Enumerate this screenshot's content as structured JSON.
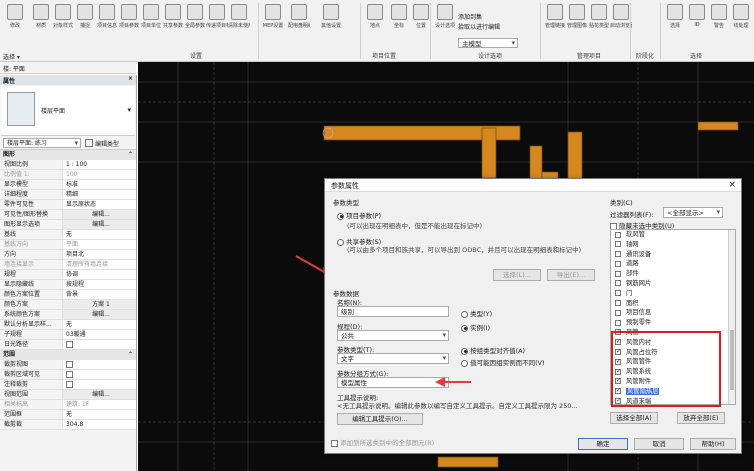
{
  "ribbon": {
    "buttons": [
      "修改",
      "材质",
      "对象样式",
      "捕捉",
      "项目信息",
      "项目参数",
      "项目单位",
      "共享参数",
      "全局参数",
      "传递项目标准",
      "清除未使用项",
      "MEP设置",
      "配电盘明细表样板",
      "其他设置",
      "地点",
      "坐标",
      "位置",
      "设计选项",
      "添加到集",
      "拾取以进行编辑",
      "管理链接",
      "管理图像",
      "贴花类型",
      "启动浏览器",
      "选择",
      "ID",
      "警告",
      "线处理"
    ],
    "groups": [
      "设置",
      "项目位置",
      "设计选项",
      "管理项目",
      "阶段化",
      "选择"
    ],
    "design_option_value": "主模型"
  },
  "selbar": {
    "label": "选择 ▾"
  },
  "typebar": {
    "label": "楼: 平面"
  },
  "palette": {
    "title": "属性",
    "type_name": "楼层平面",
    "view_selector": "楼层平面: 练习",
    "edit_type": "编辑类型",
    "section_graphics": "图形",
    "graphics_rows": [
      {
        "k": "视图比例",
        "v": "1 : 100"
      },
      {
        "k": "比例值 1:",
        "v": "100",
        "dim": true
      },
      {
        "k": "显示模型",
        "v": "标准"
      },
      {
        "k": "详细程度",
        "v": "精细"
      },
      {
        "k": "零件可见性",
        "v": "显示原状态"
      },
      {
        "k": "可见性/图形替换",
        "v": "编辑..."
      },
      {
        "k": "图形显示选项",
        "v": "编辑..."
      },
      {
        "k": "基线",
        "v": "无"
      },
      {
        "k": "基线方向",
        "v": "平面",
        "dim": true
      },
      {
        "k": "方向",
        "v": "项目北"
      },
      {
        "k": "墙连接显示",
        "v": "清理所有墙连接",
        "dim": true
      },
      {
        "k": "规程",
        "v": "协调"
      },
      {
        "k": "显示隐藏线",
        "v": "按规程"
      },
      {
        "k": "颜色方案位置",
        "v": "背景"
      },
      {
        "k": "颜色方案",
        "v": "方案 1"
      },
      {
        "k": "系统颜色方案",
        "v": "编辑..."
      },
      {
        "k": "默认分析显示样...",
        "v": "无"
      },
      {
        "k": "子规程",
        "v": "03暖通"
      },
      {
        "k": "日光路径",
        "v": ""
      }
    ],
    "section_range": "范围",
    "range_rows": [
      {
        "k": "裁剪视图",
        "v": ""
      },
      {
        "k": "裁剪区域可见",
        "v": ""
      },
      {
        "k": "注释裁剪",
        "v": ""
      },
      {
        "k": "视图范围",
        "v": "编辑..."
      },
      {
        "k": "相关标高",
        "v": "建筑: 1F",
        "dim": true
      },
      {
        "k": "范围框",
        "v": "无"
      },
      {
        "k": "截剪裁",
        "v": "304.8"
      }
    ]
  },
  "dialog": {
    "title": "参数属性",
    "close": "×",
    "param_type": "参数类型",
    "project_param": "项目参数(P)",
    "project_param_desc": "(可以出现在明细表中，但是不能出现在标记中)",
    "shared_param": "共享参数(S)",
    "shared_param_desc": "(可以由多个项目和族共享，可以导出到 ODBC，并且可以出现在明细表和标记中)",
    "select_btn": "选择(L)...",
    "export_btn": "导出(E)...",
    "param_data": "参数数据",
    "name_label": "名称(N):",
    "name_value": "级别",
    "type_radio": "类型(Y)",
    "instance_radio": "实例(I)",
    "discipline_label": "规程(D):",
    "discipline_value": "公共",
    "param_type_label": "参数类型(T):",
    "param_type_value": "文字",
    "by_group": "按组类型对齐值(A)",
    "by_instance": "值可能因组实例而不同(V)",
    "group_label": "参数分组方式(G):",
    "group_value": "模型属性",
    "tooltip_label": "工具提示说明:",
    "tooltip_text": "<无工具提示说明。编辑此参数以编写自定义工具提示。自定义工具提示限为 250...",
    "edit_tooltip": "编辑工具提示(O)...",
    "add_all": "添加到所选类别中的全部图元(R)",
    "category": "类别(C)",
    "filter_label": "过滤器列表(F):",
    "filter_value": "<全部显示>",
    "hide_unchecked": "隐藏未选中类别(U)",
    "categories": [
      {
        "t": "软风管",
        "c": false
      },
      {
        "t": "轴网",
        "c": false
      },
      {
        "t": "通讯设备",
        "c": false
      },
      {
        "t": "道路",
        "c": false
      },
      {
        "t": "部件",
        "c": false
      },
      {
        "t": "钢筋网片",
        "c": false
      },
      {
        "t": "门",
        "c": false
      },
      {
        "t": "面积",
        "c": false
      },
      {
        "t": "项目信息",
        "c": false
      },
      {
        "t": "预制零件",
        "c": false
      },
      {
        "t": "风管",
        "c": true
      },
      {
        "t": "风管内衬",
        "c": true
      },
      {
        "t": "风管占位符",
        "c": true
      },
      {
        "t": "风管管件",
        "c": true
      },
      {
        "t": "风管系统",
        "c": true
      },
      {
        "t": "风管附件",
        "c": true
      },
      {
        "t": "风管隔热层",
        "c": true,
        "hl": true
      },
      {
        "t": "风道末端",
        "c": true
      }
    ],
    "select_all": "选择全部(A)",
    "deselect_all": "放弃全部(E)",
    "ok": "确定",
    "cancel": "取消",
    "help": "帮助(H)"
  }
}
